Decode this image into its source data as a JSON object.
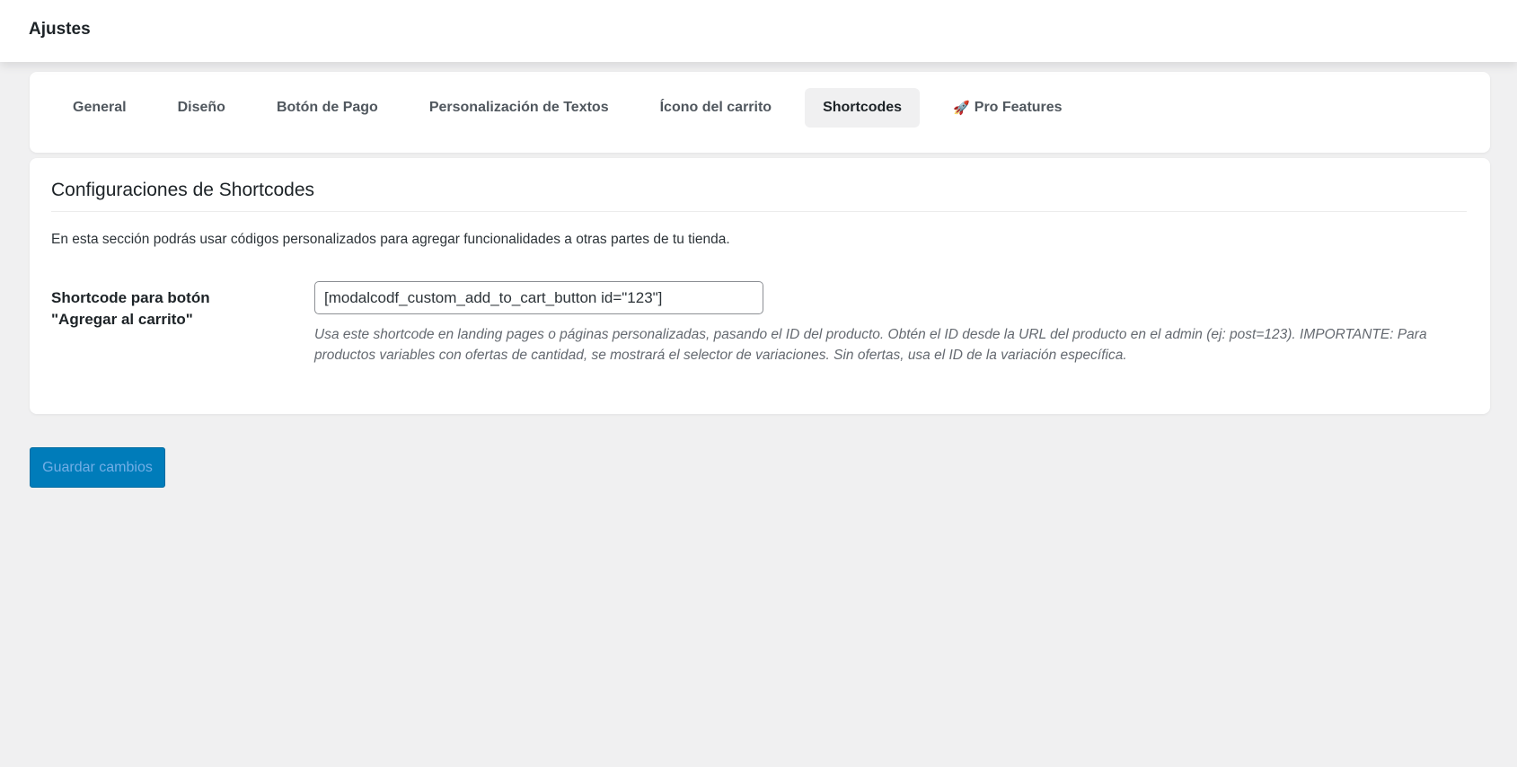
{
  "header": {
    "title": "Ajustes"
  },
  "tabs": [
    {
      "label": "General",
      "active": false
    },
    {
      "label": "Diseño",
      "active": false
    },
    {
      "label": "Botón de Pago",
      "active": false
    },
    {
      "label": "Personalización de Textos",
      "active": false
    },
    {
      "label": "Ícono del carrito",
      "active": false
    },
    {
      "label": "Shortcodes",
      "active": true
    },
    {
      "label": "Pro Features",
      "emoji": "🚀",
      "active": false
    }
  ],
  "section": {
    "title": "Configuraciones de Shortcodes",
    "description": "En esta sección podrás usar códigos personalizados para agregar funcionalidades a otras partes de tu tienda.",
    "field": {
      "label_line1": "Shortcode para botón",
      "label_line2": "\"Agregar al carrito\"",
      "value": "[modalcodf_custom_add_to_cart_button id=\"123\"]",
      "help_line1": "Usa este shortcode en landing pages o páginas personalizadas, pasando el ID del producto. Obtén el ID desde la URL del producto en el admin (ej: post=123). IMPORTANTE: Para",
      "help_line2": "productos variables con ofertas de cantidad, se mostrará el selector de variaciones. Sin ofertas, usa el ID de la variación específica."
    }
  },
  "footer": {
    "save_label": "Guardar cambios"
  },
  "colors": {
    "accent": "#007cba",
    "active_tab_bg": "#f0f0f1",
    "page_bg": "#f0f0f1"
  }
}
